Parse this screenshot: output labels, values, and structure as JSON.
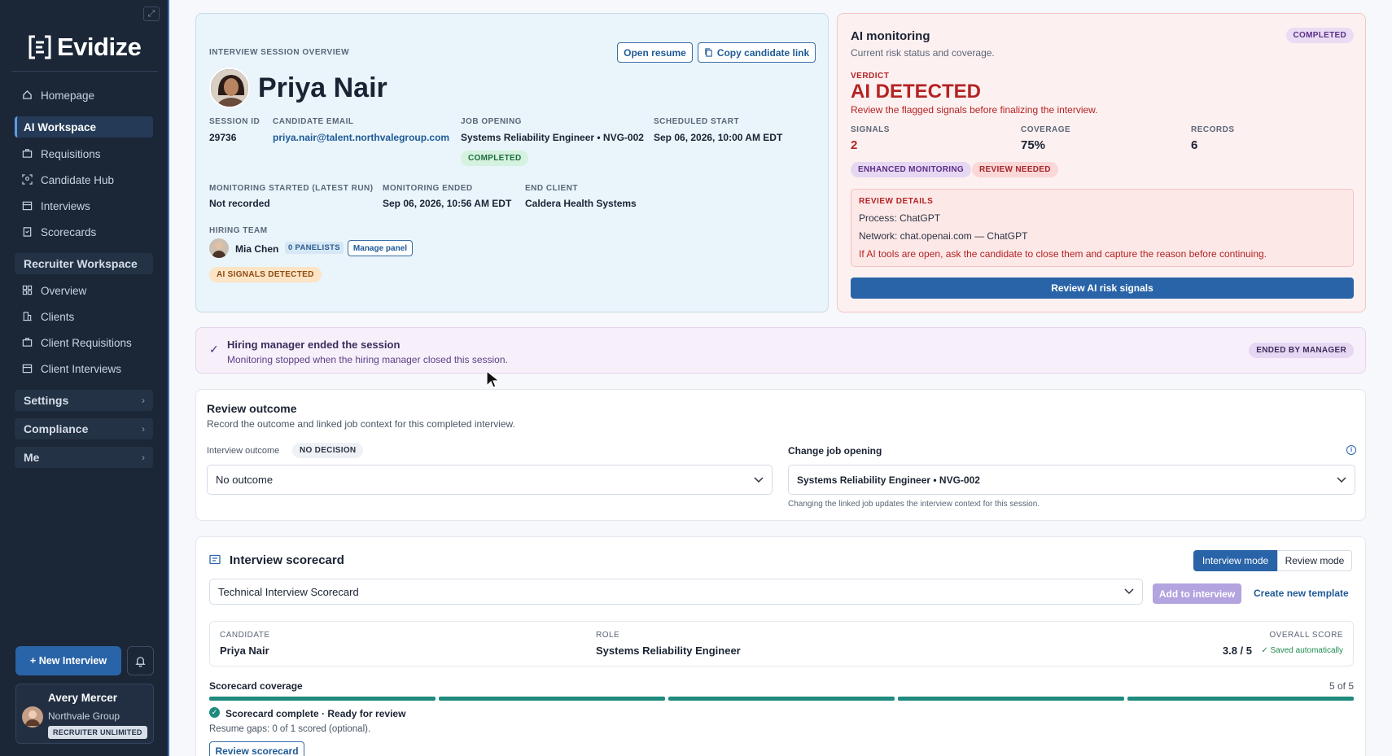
{
  "sidebar": {
    "logo": "Evidize",
    "items": [
      {
        "label": "Homepage"
      },
      {
        "label": "AI Workspace"
      },
      {
        "label": "Requisitions"
      },
      {
        "label": "Candidate Hub"
      },
      {
        "label": "Interviews"
      },
      {
        "label": "Scorecards"
      }
    ],
    "recruiter_section": "Recruiter Workspace",
    "recruiter_items": [
      {
        "label": "Overview"
      },
      {
        "label": "Clients"
      },
      {
        "label": "Client Requisitions"
      },
      {
        "label": "Client Interviews"
      }
    ],
    "settings": "Settings",
    "compliance": "Compliance",
    "me": "Me",
    "new_interview": "+ New Interview",
    "user": {
      "name": "Avery Mercer",
      "org": "Northvale Group",
      "plan": "RECRUITER UNLIMITED"
    }
  },
  "overview": {
    "heading": "INTERVIEW SESSION OVERVIEW",
    "open_resume": "Open resume",
    "copy_link": "Copy candidate link",
    "candidate_name": "Priya Nair",
    "session_id_label": "SESSION ID",
    "session_id": "29736",
    "email_label": "CANDIDATE EMAIL",
    "email": "priya.nair@talent.northvalegroup.com",
    "job_label": "JOB OPENING",
    "job": "Systems Reliability Engineer • NVG-002",
    "job_status": "COMPLETED",
    "sched_label": "SCHEDULED START",
    "sched": "Sep 06, 2026, 10:00 AM EDT",
    "mon_start_label": "MONITORING STARTED (LATEST RUN)",
    "mon_start": "Not recorded",
    "mon_end_label": "MONITORING ENDED",
    "mon_end": "Sep 06, 2026, 10:56 AM EDT",
    "client_label": "END CLIENT",
    "client": "Caldera Health Systems",
    "team_label": "HIRING TEAM",
    "team_member": "Mia Chen",
    "panelists": "0 PANELISTS",
    "manage_panel": "Manage panel",
    "ai_signals": "AI SIGNALS DETECTED"
  },
  "ai_monitoring": {
    "title": "AI monitoring",
    "subtitle": "Current risk status and coverage.",
    "status": "COMPLETED",
    "verdict_label": "VERDICT",
    "verdict": "AI DETECTED",
    "verdict_note": "Review the flagged signals before finalizing the interview.",
    "signals_label": "SIGNALS",
    "signals": "2",
    "coverage_label": "COVERAGE",
    "coverage": "75%",
    "records_label": "RECORDS",
    "records": "6",
    "tag1": "ENHANCED MONITORING",
    "tag2": "REVIEW NEEDED",
    "details_label": "REVIEW DETAILS",
    "process": "Process: ChatGPT",
    "network": "Network: chat.openai.com — ChatGPT",
    "warning": "If AI tools are open, ask the candidate to close them and capture the reason before continuing.",
    "review_button": "Review AI risk signals"
  },
  "banner": {
    "title": "Hiring manager ended the session",
    "subtitle": "Monitoring stopped when the hiring manager closed this session.",
    "badge": "ENDED BY MANAGER"
  },
  "outcome": {
    "title": "Review outcome",
    "subtitle": "Record the outcome and linked job context for this completed interview.",
    "outcome_label": "Interview outcome",
    "decision_badge": "NO DECISION",
    "outcome_value": "No outcome",
    "job_label": "Change job opening",
    "job_value": "Systems Reliability Engineer • NVG-002",
    "job_help": "Changing the linked job updates the interview context for this session."
  },
  "scorecard": {
    "title": "Interview scorecard",
    "mode_interview": "Interview mode",
    "mode_review": "Review mode",
    "template": "Technical Interview Scorecard",
    "add_button": "Add to interview",
    "create_template": "Create new template",
    "candidate_label": "CANDIDATE",
    "candidate": "Priya Nair",
    "role_label": "ROLE",
    "role": "Systems Reliability Engineer",
    "overall_label": "OVERALL SCORE",
    "overall": "3.8 / 5",
    "saved": "✓ Saved automatically",
    "coverage_label": "Scorecard coverage",
    "coverage_count": "5 of 5",
    "coverage_segments_filled": 5,
    "coverage_segments_total": 5,
    "complete_text": "Scorecard complete · Ready for review",
    "resume_gaps": "Resume gaps: 0 of 1 scored (optional).",
    "review_button": "Review scorecard"
  },
  "colors": {
    "accent": "#2a64a8",
    "danger": "#b42323",
    "success": "#1f8a7e",
    "sidebar": "#1b2637"
  }
}
